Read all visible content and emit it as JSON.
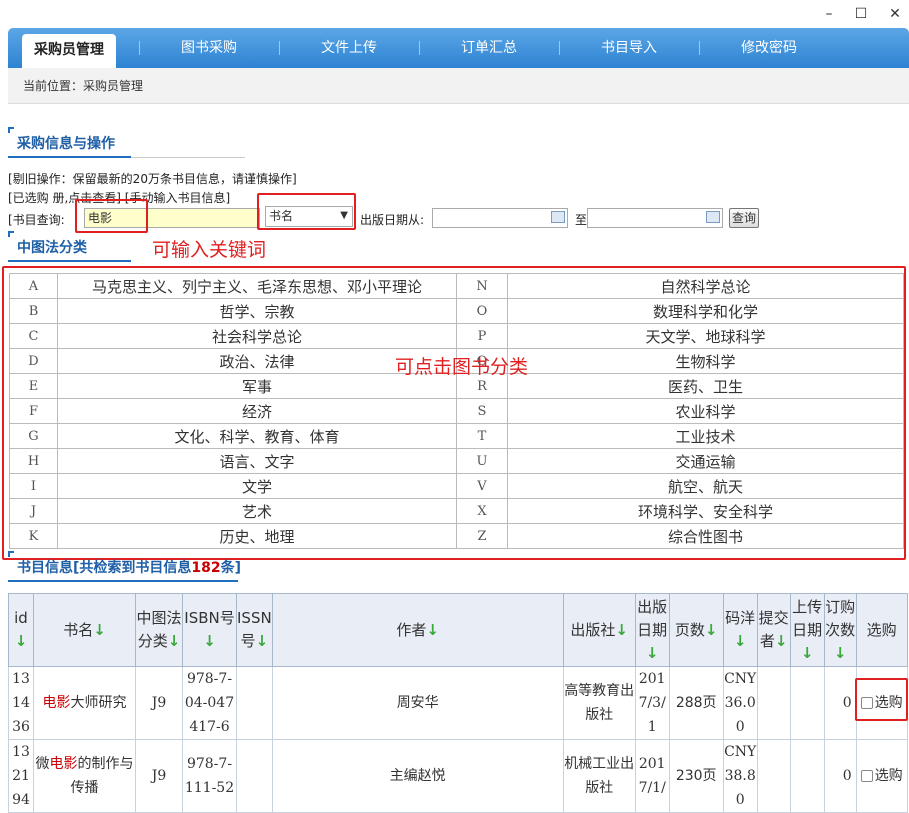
{
  "window": {
    "minimize": "–",
    "maximize": "☐",
    "close": "✕"
  },
  "nav": {
    "tabs": [
      "采购员管理",
      "图书采购",
      "文件上传",
      "订单汇总",
      "书目导入",
      "修改密码"
    ]
  },
  "breadcrumb": "当前位置：采购员管理",
  "purchase_section": {
    "title": "采购信息与操作",
    "line1": "[剔旧操作：保留最新的20万条书目信息，请谨慎操作]",
    "line2": "[已选购 册,点击查看]  [手动输入书目信息]",
    "search_label": "[书目查询:",
    "search_value": "电影",
    "field_select": "书名",
    "date_from_label": "出版日期从:",
    "date_to_label": "至",
    "query_button": "查询"
  },
  "annotations": {
    "keyword": "可输入关键词",
    "category": "可点击图书分类"
  },
  "clc_section": {
    "title": "中图法分类",
    "rows": [
      [
        "A",
        "马克思主义、列宁主义、毛泽东思想、邓小平理论",
        "N",
        "自然科学总论"
      ],
      [
        "B",
        "哲学、宗教",
        "O",
        "数理科学和化学"
      ],
      [
        "C",
        "社会科学总论",
        "P",
        "天文学、地球科学"
      ],
      [
        "D",
        "政治、法律",
        "Q",
        "生物科学"
      ],
      [
        "E",
        "军事",
        "R",
        "医药、卫生"
      ],
      [
        "F",
        "经济",
        "S",
        "农业科学"
      ],
      [
        "G",
        "文化、科学、教育、体育",
        "T",
        "工业技术"
      ],
      [
        "H",
        "语言、文字",
        "U",
        "交通运输"
      ],
      [
        "I",
        "文学",
        "V",
        "航空、航天"
      ],
      [
        "J",
        "艺术",
        "X",
        "环境科学、安全科学"
      ],
      [
        "K",
        "历史、地理",
        "Z",
        "综合性图书"
      ]
    ]
  },
  "books_section": {
    "title_prefix": "书目信息[共检索到书目信息",
    "count": "182",
    "title_suffix": "条]",
    "headers": {
      "id": "id",
      "title": "书名",
      "clc": "中图法分类",
      "isbn": "ISBN号",
      "issn": "ISSN号",
      "author": "作者",
      "publisher": "出版社",
      "date": "出版日期",
      "pages": "页数",
      "price": "码洋",
      "submitter": "提交者",
      "upload_date": "上传日期",
      "orders": "订购次数",
      "select": "选购"
    },
    "rows": [
      {
        "id": "131436",
        "title_pre": "",
        "title_hl": "电影",
        "title_post": "大师研究",
        "clc": "J9",
        "isbn": "978-7-04-047417-6",
        "issn": "",
        "author": "周安华",
        "publisher": "高等教育出版社",
        "date": "2017/3/1",
        "pages": "288页",
        "price": "CNY36.00",
        "submitter": "",
        "upload_date": "",
        "orders": "0",
        "select": "选购"
      },
      {
        "id": "132194",
        "title_pre": "微",
        "title_hl": "电影",
        "title_post": "的制作与传播",
        "clc": "J9",
        "isbn": "978-7-111-52",
        "issn": "",
        "author": "主编赵悦",
        "publisher": "机械工业出版社",
        "date": "2017/1/",
        "pages": "230页",
        "price": "CNY38.80",
        "submitter": "",
        "upload_date": "",
        "orders": "0",
        "select": "选购"
      }
    ]
  }
}
